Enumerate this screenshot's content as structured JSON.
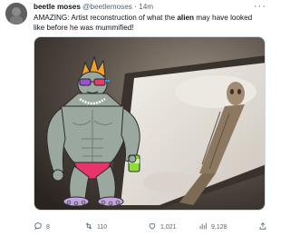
{
  "tweet": {
    "display_name": "beetle moses",
    "handle": "@beetlemoses",
    "separator": "·",
    "time": "14m",
    "more_label": "···",
    "text_before": "AMAZING: Artist reconstruction of what the ",
    "text_bold": "alien",
    "text_after": " may have looked like before he was mummified!"
  },
  "actions": {
    "reply_count": "8",
    "retweet_count": "110",
    "like_count": "1,021",
    "views_count": "9,128"
  },
  "icons": {
    "reply": "reply-icon",
    "retweet": "retweet-icon",
    "like": "heart-icon",
    "views": "views-icon",
    "share": "share-icon"
  },
  "colors": {
    "text": "#0f1419",
    "secondary": "#536471",
    "border": "#cfd9de",
    "character_skin": "#9aa8a0",
    "crown": "#f0a32a",
    "speedo": "#e8336b"
  }
}
